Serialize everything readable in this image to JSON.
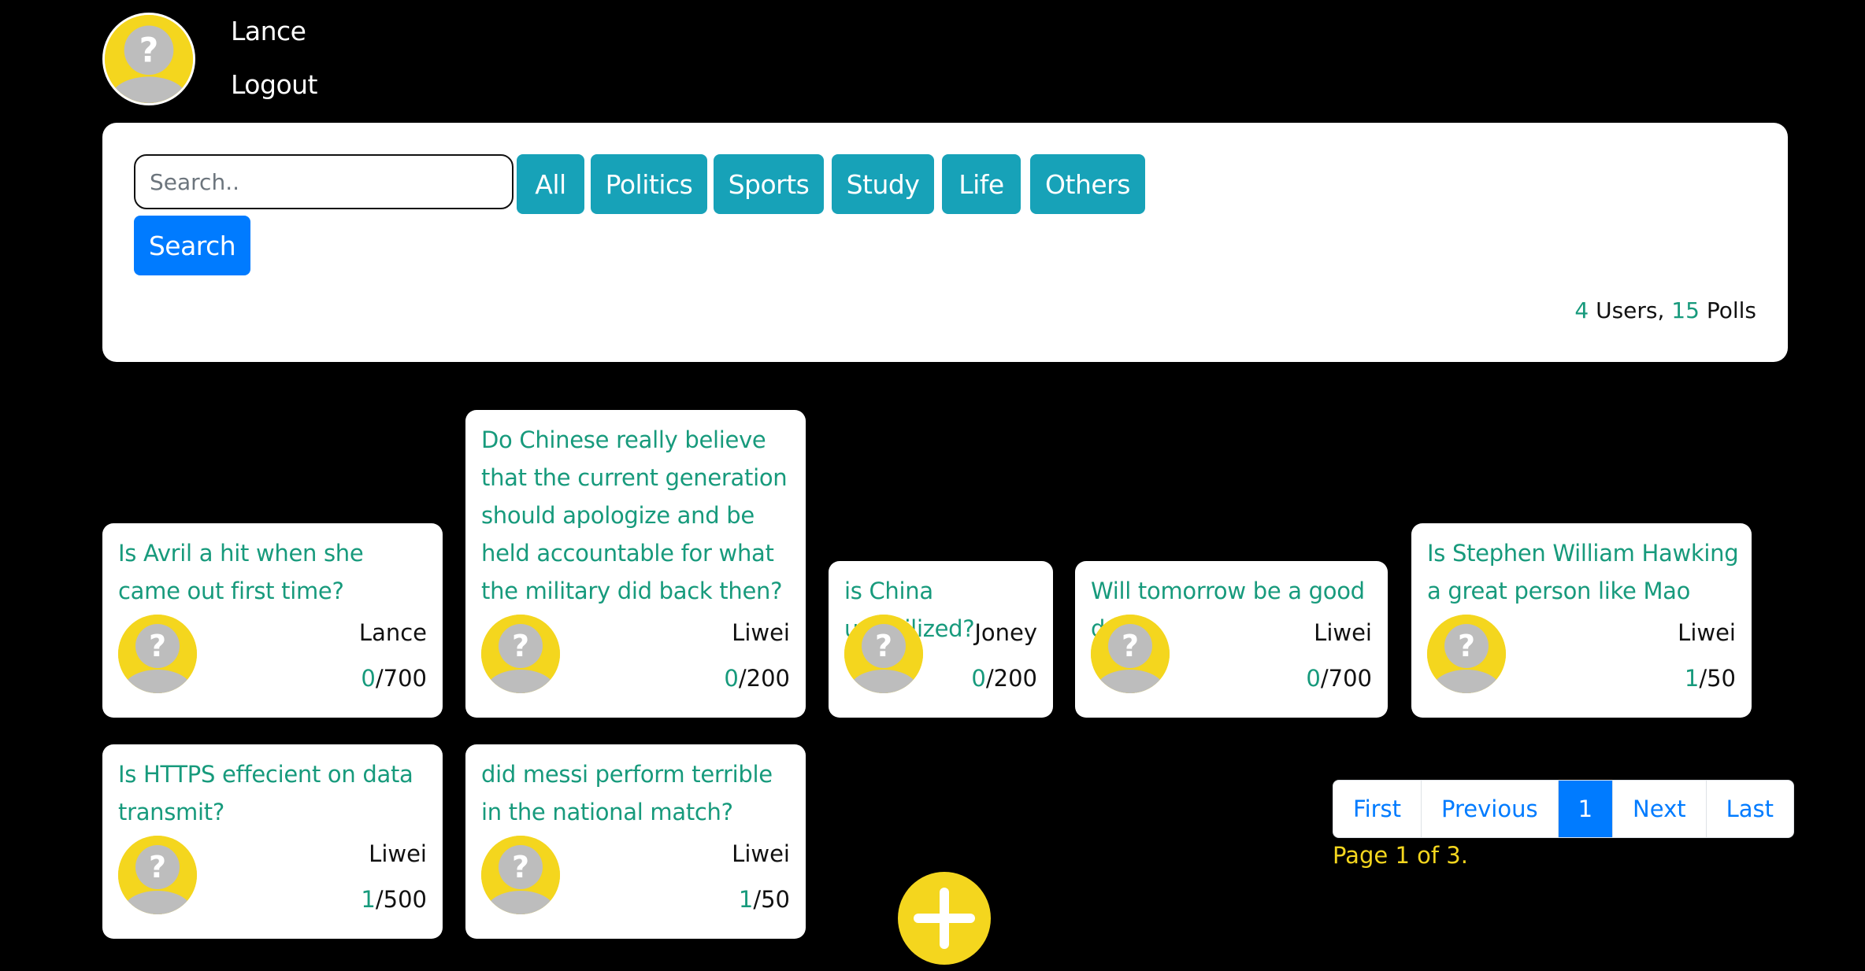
{
  "user": {
    "name": "Lance",
    "logout_label": "Logout"
  },
  "search": {
    "placeholder": "Search..",
    "button_label": "Search"
  },
  "categories": [
    "All",
    "Politics",
    "Sports",
    "Study",
    "Life",
    "Others"
  ],
  "stats": {
    "users_count": "4",
    "users_label": " Users, ",
    "polls_count": "15",
    "polls_label": " Polls"
  },
  "polls": [
    {
      "question": "Is Avril a hit when she came out first time?",
      "author": "Lance",
      "votes": "0",
      "limit": "/700"
    },
    {
      "question": "Do Chinese really believe that the current generation should apologize and be held accountable for what the military did back then?",
      "author": "Liwei",
      "votes": "0",
      "limit": "/200"
    },
    {
      "question": "is China uncivilized?",
      "author": "Joney",
      "votes": "0",
      "limit": "/200"
    },
    {
      "question": "Will tomorrow be a good day",
      "author": "Liwei",
      "votes": "0",
      "limit": "/700"
    },
    {
      "question": "Is Stephen William Hawking a great person like Mao",
      "author": "Liwei",
      "votes": "1",
      "limit": "/50"
    },
    {
      "question": "Is HTTPS effecient on data transmit?",
      "author": "Liwei",
      "votes": "1",
      "limit": "/500"
    },
    {
      "question": "did messi perform terrible in the national match?",
      "author": "Liwei",
      "votes": "1",
      "limit": "/50"
    }
  ],
  "pagination": {
    "first": "First",
    "previous": "Previous",
    "current": "1",
    "next": "Next",
    "last": "Last"
  },
  "page_info": {
    "prefix": "Page ",
    "current": "1",
    "mid": " of ",
    "total": "3",
    "suffix": "."
  },
  "colors": {
    "background": "#000000",
    "accent_yellow": "#f4d61e",
    "teal": "#179a7c",
    "category": "#17a2b8",
    "primary": "#007bff"
  },
  "icons": {
    "avatar": "question-avatar-icon",
    "add": "plus-icon"
  }
}
